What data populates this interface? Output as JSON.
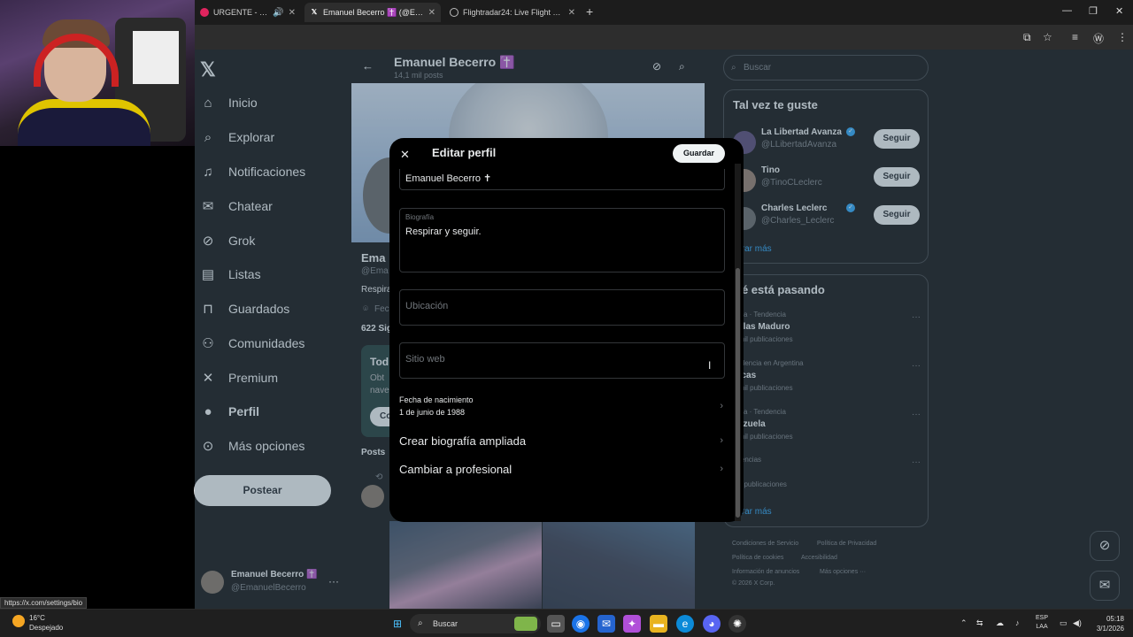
{
  "browser": {
    "tabs": [
      {
        "title": "URGENTE - EXPLOS",
        "favicon_color": "#e0245e"
      },
      {
        "title": "Emanuel Becerro ✝️ (@Emanu",
        "favicon_color": "#000000"
      },
      {
        "title": "Flightradar24: Live Flight Tracke",
        "favicon_color": "#888888"
      }
    ],
    "status_url": "https://x.com/settings/bio"
  },
  "sidebar": {
    "items": [
      {
        "label": "Inicio",
        "icon": "home-icon",
        "glyph": "⌂"
      },
      {
        "label": "Explorar",
        "icon": "search-icon",
        "glyph": "⌕"
      },
      {
        "label": "Notificaciones",
        "icon": "bell-icon",
        "glyph": "♫"
      },
      {
        "label": "Chatear",
        "icon": "mail-icon",
        "glyph": "✉"
      },
      {
        "label": "Grok",
        "icon": "grok-icon",
        "glyph": "⊘"
      },
      {
        "label": "Listas",
        "icon": "list-icon",
        "glyph": "▤"
      },
      {
        "label": "Guardados",
        "icon": "bookmark-icon",
        "glyph": "⊓"
      },
      {
        "label": "Comunidades",
        "icon": "people-icon",
        "glyph": "⚇"
      },
      {
        "label": "Premium",
        "icon": "x-icon",
        "glyph": "✕"
      },
      {
        "label": "Perfil",
        "icon": "person-icon",
        "glyph": "●"
      },
      {
        "label": "Más opciones",
        "icon": "more-circle-icon",
        "glyph": "⊙"
      }
    ],
    "post_label": "Postear",
    "account": {
      "name": "Emanuel Becerro ✝️",
      "handle": "@EmanuelBecerro"
    }
  },
  "header": {
    "name": "Emanuel Becerro ✝️",
    "post_count": "14,1 mil posts"
  },
  "profile_bg": {
    "name_stub": "Ema",
    "handle_stub": "@Ema",
    "bio_stub": "Respira",
    "loc_stub": "Fec",
    "follow_stub": "622 Sig",
    "promo_title": "Tod",
    "promo_l1": "Obt",
    "promo_l2": "nave",
    "promo_btn": "Co",
    "tab_posts": "Posts"
  },
  "modal": {
    "title": "Editar perfil",
    "save_label": "Guardar",
    "name_value": "Emanuel Becerro ✝",
    "bio_label": "Biografía",
    "bio_value": "Respirar y seguir.",
    "location_placeholder": "Ubicación",
    "website_placeholder": "Sitio web",
    "birth_label": "Fecha de nacimiento",
    "birth_value": "1 de junio de 1988",
    "extended_bio": "Crear biografía ampliada",
    "switch_pro": "Cambiar a profesional"
  },
  "right": {
    "search_placeholder": "Buscar",
    "suggest_title": "Tal vez te guste",
    "suggestions": [
      {
        "name": "La Libertad Avanza",
        "handle": "@LLibertadAvanza",
        "button": "Seguir",
        "verified": true
      },
      {
        "name": "Tino",
        "handle": "@TinoCLeclerc",
        "button": "Seguir",
        "verified": false
      },
      {
        "name": "Charles Leclerc",
        "handle": "@Charles_Leclerc",
        "button": "Seguir",
        "verified": true
      }
    ],
    "show_more_1": "strar más",
    "trends_title": "ué está pasando",
    "trends": [
      {
        "context": "lítica · Tendencia",
        "name": "colas Maduro",
        "count": "1 mil publicaciones"
      },
      {
        "context": "endencia en Argentina",
        "name": "racas",
        "count": "3 mil publicaciones"
      },
      {
        "context": "lítica · Tendencia",
        "name": "nezuela",
        "count": "0 mil publicaciones"
      },
      {
        "context": "ndencias",
        "name": "fía",
        "count": "mil publicaciones"
      }
    ],
    "show_more_2": "strar más",
    "footer": {
      "l1a": "Condiciones de Servicio",
      "l1b": "Política de Privacidad",
      "l2a": "Política de cookies",
      "l2b": "Accesibilidad",
      "l3a": "Información de anuncios",
      "l3b": "Más opciones ···",
      "l4": "© 2026 X Corp."
    }
  },
  "taskbar": {
    "temp": "16°C",
    "condition": "Despejado",
    "search": "Buscar",
    "lang1": "ESP",
    "lang2": "LAA",
    "time": "05:18",
    "date": "3/1/2026"
  },
  "colors": {
    "accent": "#1d9bf0",
    "background": "#000000",
    "verified": "#1d9bf0"
  }
}
